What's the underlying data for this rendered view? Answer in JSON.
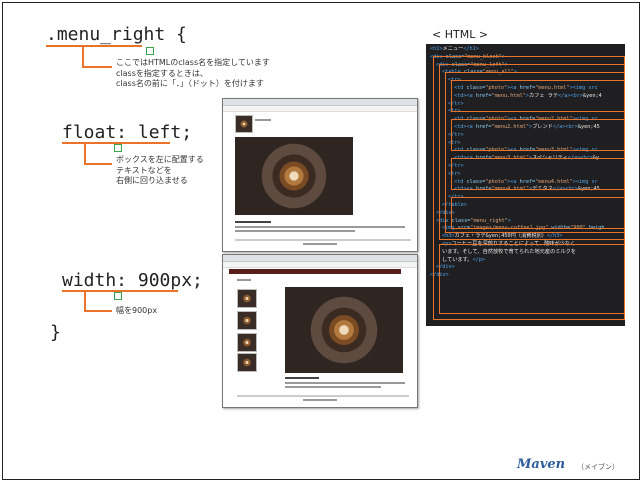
{
  "code": {
    "selector": ".menu_right {",
    "prop_float": "float: left;",
    "prop_width": "width: 900px;",
    "close": "}"
  },
  "notes": {
    "selector_note": [
      "ここではHTMLのclass名を指定しています",
      "classを指定するときは、",
      "class名の前に「．」（ドット）を付けます"
    ],
    "float_note": [
      "ボックスを左に配置する",
      "テキストなどを",
      "右側に回り込ませる"
    ],
    "width_note": "幅を900px"
  },
  "html_panel": {
    "header": "< HTML >",
    "lines": [
      {
        "indent": 0,
        "parts": [
          [
            "t",
            "<h1>"
          ],
          [
            "x",
            "メニュー"
          ],
          [
            "t",
            "</h1>"
          ]
        ]
      },
      {
        "indent": 0,
        "parts": [
          [
            "t",
            "<div "
          ],
          [
            "a",
            "class="
          ],
          [
            "s",
            "\"menu_block\""
          ],
          [
            "t",
            ">"
          ]
        ]
      },
      {
        "indent": 1,
        "parts": [
          [
            "t",
            "<div "
          ],
          [
            "a",
            "class="
          ],
          [
            "s",
            "\"menu_left\""
          ],
          [
            "t",
            ">"
          ]
        ]
      },
      {
        "indent": 2,
        "parts": [
          [
            "t",
            "<table "
          ],
          [
            "a",
            "class="
          ],
          [
            "s",
            "\"menu_all\""
          ],
          [
            "t",
            ">"
          ]
        ]
      },
      {
        "indent": 3,
        "parts": [
          [
            "t",
            "<tr>"
          ]
        ]
      },
      {
        "indent": 4,
        "parts": [
          [
            "t",
            "<td "
          ],
          [
            "a",
            "class="
          ],
          [
            "s",
            "\"photo\""
          ],
          [
            "t",
            "><a "
          ],
          [
            "a",
            "href="
          ],
          [
            "s",
            "\"menu.html\""
          ],
          [
            "t",
            "><img src"
          ]
        ]
      },
      {
        "indent": 4,
        "parts": [
          [
            "t",
            "<td><a "
          ],
          [
            "a",
            "href="
          ],
          [
            "s",
            "\"menu.html\""
          ],
          [
            "t",
            ">"
          ],
          [
            "x",
            "カフェ ラテ"
          ],
          [
            "t",
            "</a><br>"
          ],
          [
            "x",
            "&yen;4"
          ]
        ]
      },
      {
        "indent": 3,
        "parts": [
          [
            "t",
            "</tr>"
          ]
        ]
      },
      {
        "indent": 3,
        "parts": [
          [
            "t",
            "<tr>"
          ]
        ]
      },
      {
        "indent": 4,
        "parts": [
          [
            "t",
            "<td "
          ],
          [
            "a",
            "class="
          ],
          [
            "s",
            "\"photo\""
          ],
          [
            "t",
            "><a "
          ],
          [
            "a",
            "href="
          ],
          [
            "s",
            "\"menu2.html\""
          ],
          [
            "t",
            "><img sr"
          ]
        ]
      },
      {
        "indent": 4,
        "parts": [
          [
            "t",
            "<td><a "
          ],
          [
            "a",
            "href="
          ],
          [
            "s",
            "\"menu2.html\""
          ],
          [
            "t",
            ">"
          ],
          [
            "x",
            "ブレンド"
          ],
          [
            "t",
            "</a><br>"
          ],
          [
            "x",
            "&yen;45"
          ]
        ]
      },
      {
        "indent": 3,
        "parts": [
          [
            "t",
            "</tr>"
          ]
        ]
      },
      {
        "indent": 3,
        "parts": [
          [
            "t",
            "<tr>"
          ]
        ]
      },
      {
        "indent": 4,
        "parts": [
          [
            "t",
            "<td "
          ],
          [
            "a",
            "class="
          ],
          [
            "s",
            "\"photo\""
          ],
          [
            "t",
            "><a "
          ],
          [
            "a",
            "href="
          ],
          [
            "s",
            "\"menu3.html\""
          ],
          [
            "t",
            "><img sr"
          ]
        ]
      },
      {
        "indent": 4,
        "parts": [
          [
            "t",
            "<td><a "
          ],
          [
            "a",
            "href="
          ],
          [
            "s",
            "\"menu3.html\""
          ],
          [
            "t",
            ">"
          ],
          [
            "x",
            "スペシャリティ"
          ],
          [
            "t",
            "</a><br>"
          ],
          [
            "x",
            "&y"
          ]
        ]
      },
      {
        "indent": 3,
        "parts": [
          [
            "t",
            "</tr>"
          ]
        ]
      },
      {
        "indent": 3,
        "parts": [
          [
            "t",
            "<tr>"
          ]
        ]
      },
      {
        "indent": 4,
        "parts": [
          [
            "t",
            "<td "
          ],
          [
            "a",
            "class="
          ],
          [
            "s",
            "\"photo\""
          ],
          [
            "t",
            "><a "
          ],
          [
            "a",
            "href="
          ],
          [
            "s",
            "\"menu4.html\""
          ],
          [
            "t",
            "><img sr"
          ]
        ]
      },
      {
        "indent": 4,
        "parts": [
          [
            "t",
            "<td><a "
          ],
          [
            "a",
            "href="
          ],
          [
            "s",
            "\"menu4.html\""
          ],
          [
            "t",
            ">"
          ],
          [
            "x",
            "デミタス"
          ],
          [
            "t",
            "</a><br>"
          ],
          [
            "x",
            "&yen;45"
          ]
        ]
      },
      {
        "indent": 3,
        "parts": [
          [
            "t",
            "</tr>"
          ]
        ]
      },
      {
        "indent": 2,
        "parts": [
          [
            "t",
            "</table>"
          ]
        ]
      },
      {
        "indent": 1,
        "parts": [
          [
            "t",
            "</div>"
          ]
        ]
      },
      {
        "indent": 1,
        "parts": [
          [
            "t",
            "<div "
          ],
          [
            "a",
            "class="
          ],
          [
            "s",
            "\"menu_right\""
          ],
          [
            "t",
            ">"
          ]
        ]
      },
      {
        "indent": 2,
        "parts": [
          [
            "t",
            "<img "
          ],
          [
            "a",
            "src="
          ],
          [
            "s",
            "\"images/menu-coffee1.jpg\""
          ],
          [
            "a",
            " width="
          ],
          [
            "s",
            "\"900\""
          ],
          [
            "a",
            " heigh"
          ]
        ]
      },
      {
        "indent": 2,
        "parts": [
          [
            "t",
            "<h3>"
          ],
          [
            "x",
            "カフェ・ラテ&yen;450円（消費税別）"
          ],
          [
            "t",
            "</h3>"
          ]
        ]
      },
      {
        "indent": 2,
        "parts": [
          [
            "t",
            "<p>"
          ],
          [
            "x",
            "コーヒー豆を深煎りすることによって、酸味が少なく"
          ]
        ]
      },
      {
        "indent": 2,
        "parts": [
          [
            "x",
            "います。そして、自然放牧で育てられた地元産のミルクを"
          ]
        ]
      },
      {
        "indent": 2,
        "parts": [
          [
            "x",
            "しています。"
          ],
          [
            "t",
            "</p>"
          ]
        ]
      },
      {
        "indent": 1,
        "parts": [
          [
            "t",
            "</div>"
          ]
        ]
      },
      {
        "indent": 0,
        "parts": [
          [
            "t",
            "</div>"
          ]
        ]
      }
    ]
  },
  "brand": {
    "name": "Maven",
    "sub": "（メイブン）"
  }
}
